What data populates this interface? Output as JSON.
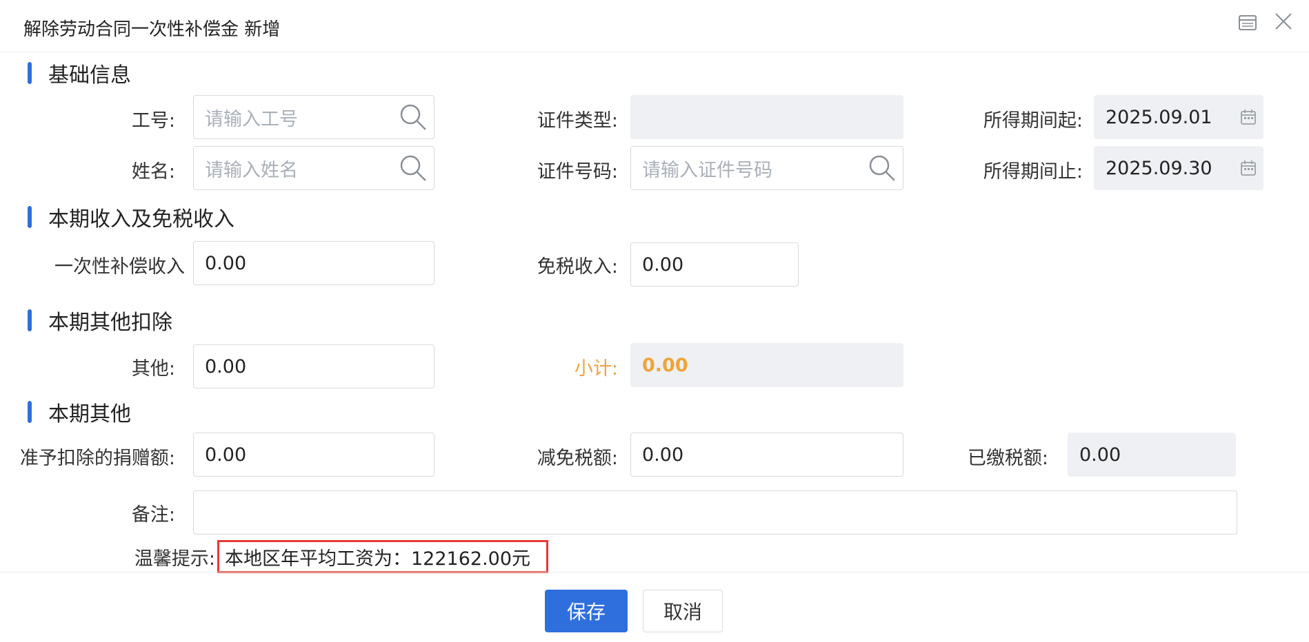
{
  "window": {
    "title": "解除劳动合同一次性补偿金 新增",
    "maximize_icon": "maximize-icon",
    "close_icon": "close-icon"
  },
  "sections": {
    "basic": "基础信息",
    "income": "本期收入及免税收入",
    "deductions": "本期其他扣除",
    "other": "本期其他"
  },
  "basic": {
    "emp_no_label": "工号:",
    "emp_no_placeholder": "请输入工号",
    "id_type_label": "证件类型:",
    "id_type_value": "",
    "period_start_label": "所得期间起:",
    "period_start_value": "2025.09.01",
    "name_label": "姓名:",
    "name_placeholder": "请输入姓名",
    "id_no_label": "证件号码:",
    "id_no_placeholder": "请输入证件号码",
    "period_end_label": "所得期间止:",
    "period_end_value": "2025.09.30"
  },
  "income": {
    "compensation_label": "一次性补偿收入",
    "compensation_value": "0.00",
    "tax_free_label": "免税收入:",
    "tax_free_value": "0.00"
  },
  "deductions": {
    "other_label": "其他:",
    "other_value": "0.00",
    "subtotal_label": "小计:",
    "subtotal_value": "0.00"
  },
  "other": {
    "donation_label": "准予扣除的捐赠额:",
    "donation_value": "0.00",
    "tax_relief_label": "减免税额:",
    "tax_relief_value": "0.00",
    "tax_paid_label": "已缴税额:",
    "tax_paid_value": "0.00",
    "remark_label": "备注:",
    "remark_value": "",
    "hint_label": "温馨提示:",
    "hint_text": "本地区年平均工资为：122162.00元"
  },
  "footer": {
    "save_label": "保存",
    "cancel_label": "取消"
  },
  "colors": {
    "accent": "#2f6fdd",
    "warning": "#f0a33c",
    "highlight_border": "#e53935"
  }
}
